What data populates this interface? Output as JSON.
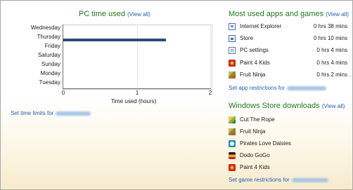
{
  "pc_time": {
    "title": "PC time used",
    "view_all": "(View all)",
    "days": [
      "Wednesday",
      "Thursday",
      "Friday",
      "Saturday",
      "Sunday",
      "Monday",
      "Tuesday"
    ],
    "x_ticks": [
      "0",
      "1",
      "2"
    ],
    "x_label": "Time used (hours)",
    "set_limits_label": "Set time limits for",
    "chart_data": {
      "type": "bar",
      "orientation": "horizontal",
      "categories": [
        "Wednesday",
        "Thursday",
        "Friday",
        "Saturday",
        "Sunday",
        "Monday",
        "Tuesday"
      ],
      "values": [
        0,
        1.4,
        0,
        0,
        0,
        0,
        0
      ],
      "xlabel": "Time used (hours)",
      "xlim": [
        0,
        2
      ],
      "bar_color": "#2b4d7a"
    }
  },
  "most_used": {
    "title": "Most used apps and games",
    "view_all": "(View all)",
    "items": [
      {
        "icon": "internet-explorer-icon",
        "name": "Internet Explorer",
        "time": "0 hrs 38 mins"
      },
      {
        "icon": "store-icon",
        "name": "Store",
        "time": "0 hrs 10 mins"
      },
      {
        "icon": "pc-settings-icon",
        "name": "PC settings",
        "time": "0 hrs 4 mins"
      },
      {
        "icon": "paint-4-kids-icon",
        "name": "Paint 4 Kids",
        "time": "0 hrs 4 mins"
      },
      {
        "icon": "fruit-ninja-icon",
        "name": "Fruit Ninja",
        "time": "0 hrs 2 mins"
      }
    ],
    "set_restrictions_label": "Set app restrictions for"
  },
  "store_downloads": {
    "title": "Windows Store downloads",
    "view_all": "(View all)",
    "items": [
      {
        "icon": "cut-the-rope-icon",
        "name": "Cut The Rope"
      },
      {
        "icon": "fruit-ninja-icon",
        "name": "Fruit Ninja"
      },
      {
        "icon": "pirates-love-daisies-icon",
        "name": "Pirates Love Daisies"
      },
      {
        "icon": "dodo-gogo-icon",
        "name": "Dodo GoGo"
      },
      {
        "icon": "paint-4-kids-icon",
        "name": "Paint 4 Kids"
      }
    ],
    "set_restrictions_label": "Set game restrictions for"
  },
  "colors": {
    "heading": "#1f7a1f",
    "link": "#1f5fb0",
    "bar": "#2b4d7a"
  }
}
